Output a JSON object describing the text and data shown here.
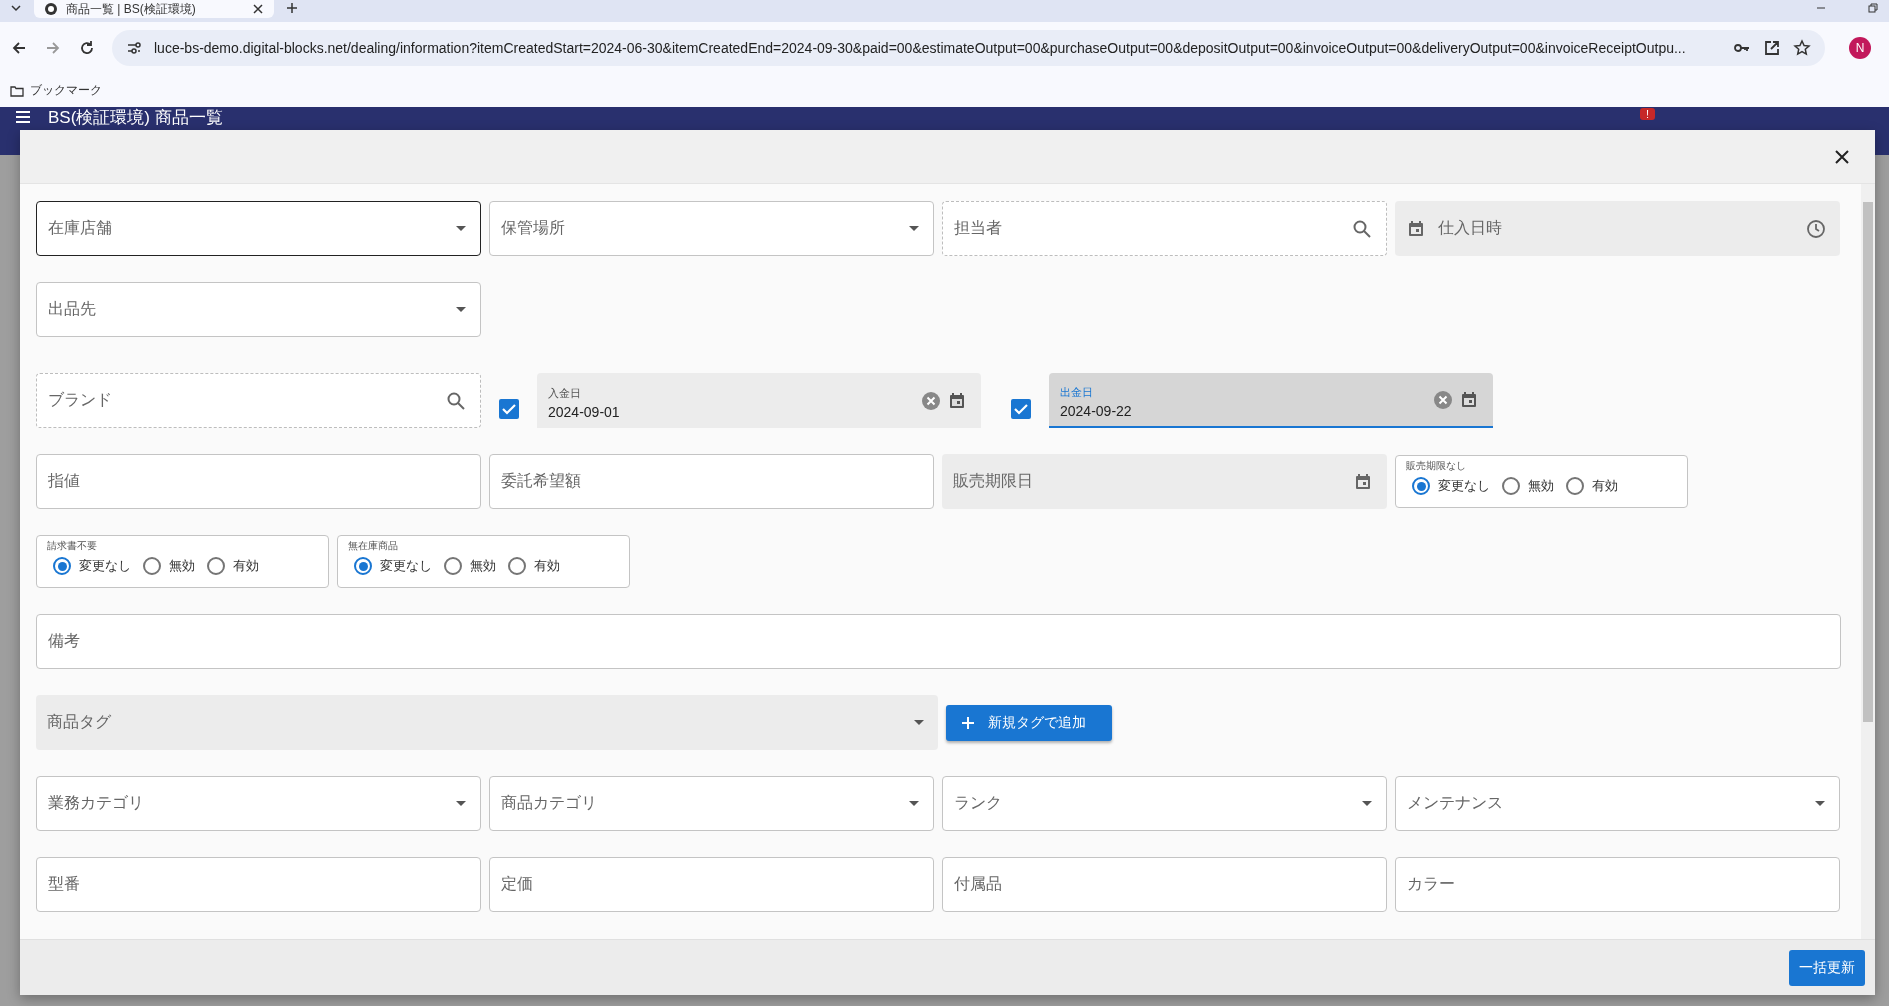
{
  "browser": {
    "tab": {
      "title": "商品一覧 | BS(検証環境)"
    },
    "url": "luce-bs-demo.digital-blocks.net/dealing/information?itemCreatedStart=2024-06-30&itemCreatedEnd=2024-09-30&paid=00&estimateOutput=00&purchaseOutput=00&depositOutput=00&invoiceOutput=00&deliveryOutput=00&invoiceReceiptOutpu...",
    "profile": "N",
    "bookmarks": [
      {
        "label": "ブックマーク"
      }
    ]
  },
  "app_header": {
    "title": "BS(検証環境) 商品一覧",
    "badge": "!"
  },
  "dialog": {
    "rows": [
      {
        "items": [
          {
            "kind": "select",
            "label": "在庫店舗",
            "focused": true
          },
          {
            "kind": "select",
            "label": "保管場所",
            "focused": false
          },
          {
            "kind": "search",
            "label": "担当者",
            "focused": false
          },
          {
            "kind": "datetime",
            "label": "仕入日時",
            "focused": false
          }
        ]
      },
      {
        "items": [
          {
            "kind": "select",
            "label": "出品先",
            "focused": false
          }
        ]
      },
      {
        "items": [
          {
            "kind": "search",
            "label": "ブランド",
            "focused": false
          },
          {
            "kind": "date-check",
            "checked": true,
            "label": "入金日",
            "value": "2024-09-01",
            "focused": false
          },
          {
            "kind": "date-check",
            "checked": true,
            "label": "出金日",
            "value": "2024-09-22",
            "focused": true
          }
        ]
      },
      {
        "items": [
          {
            "kind": "text",
            "label": "指値",
            "focused": false
          },
          {
            "kind": "text",
            "label": "委託希望額",
            "focused": false
          },
          {
            "kind": "date",
            "label": "販売期限日",
            "focused": false
          },
          {
            "kind": "radio",
            "label": "販売期限なし",
            "focused": false,
            "options": [
              {
                "label": "変更なし",
                "selected": true
              },
              {
                "label": "無効",
                "selected": false
              },
              {
                "label": "有効",
                "selected": false
              }
            ]
          }
        ]
      },
      {
        "items": [
          {
            "kind": "radio",
            "label": "請求書不要",
            "focused": false,
            "options": [
              {
                "label": "変更なし",
                "selected": true
              },
              {
                "label": "無効",
                "selected": false
              },
              {
                "label": "有効",
                "selected": false
              }
            ]
          },
          {
            "kind": "radio",
            "label": "無在庫商品",
            "focused": false,
            "options": [
              {
                "label": "変更なし",
                "selected": true
              },
              {
                "label": "無効",
                "selected": false
              },
              {
                "label": "有効",
                "selected": false
              }
            ]
          }
        ]
      },
      {
        "items": [
          {
            "kind": "textarea",
            "label": "備考",
            "focused": false
          }
        ]
      },
      {
        "items": [
          {
            "kind": "tag-select",
            "label": "商品タグ",
            "focused": false
          },
          {
            "kind": "button",
            "label": "新規タグで追加"
          }
        ]
      },
      {
        "items": [
          {
            "kind": "select",
            "label": "業務カテゴリ",
            "focused": false
          },
          {
            "kind": "select",
            "label": "商品カテゴリ",
            "focused": false
          },
          {
            "kind": "select",
            "label": "ランク",
            "focused": false
          },
          {
            "kind": "select",
            "label": "メンテナンス",
            "focused": false
          }
        ]
      },
      {
        "items": [
          {
            "kind": "text",
            "label": "型番",
            "focused": false
          },
          {
            "kind": "text",
            "label": "定価",
            "focused": false
          },
          {
            "kind": "text",
            "label": "付属品",
            "focused": false
          },
          {
            "kind": "text",
            "label": "カラー",
            "focused": false
          }
        ]
      }
    ],
    "submit": "一括更新"
  }
}
